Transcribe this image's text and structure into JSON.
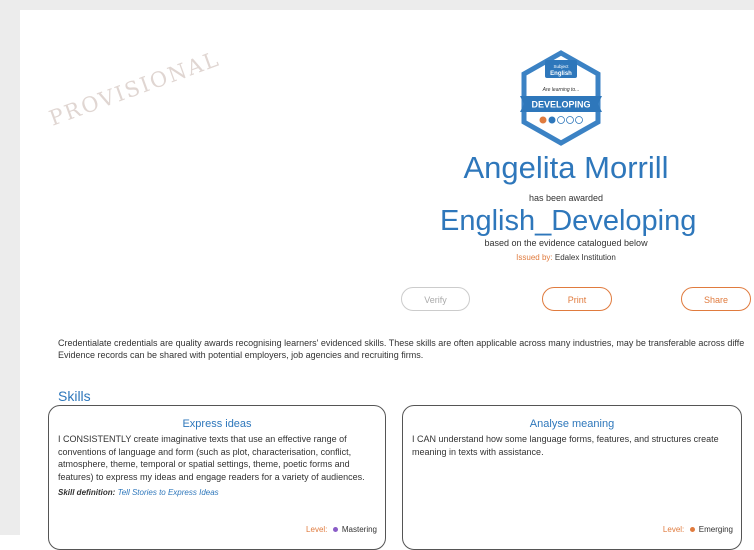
{
  "watermark": "PROVISIONAL",
  "badge": {
    "top_label": "Subject",
    "subject": "English",
    "tagline": "Are learning to...",
    "level": "DEVELOPING",
    "colors": {
      "hex": "#3b82c4",
      "ribbon": "#2e77bb",
      "dot_active": "#e07b3e",
      "dot_second": "#2e77bb"
    }
  },
  "recipient": {
    "name": "Angelita Morrill"
  },
  "awarded_text": "has been awarded",
  "credential": {
    "name": "English_Developing"
  },
  "basis_text": "based on the evidence catalogued below",
  "issuer": {
    "label": "Issued by:",
    "name": "Edalex Institution"
  },
  "actions": {
    "verify": "Verify",
    "print": "Print",
    "share": "Share"
  },
  "description": {
    "line1": "Credentialate credentials are quality awards recognising learners' evidenced skills. These skills are often applicable across many industries, may be transferable across diffe",
    "line2": "Evidence records can be shared with potential employers, job agencies and recruiting firms."
  },
  "skills_heading": "Skills",
  "skills": [
    {
      "title": "Express ideas",
      "text": "I CONSISTENTLY create imaginative texts that use an effective range of conventions of language and form (such as plot, characterisation, conflict, atmosphere, theme, temporal or spatial settings, theme, poetic forms and features) to express my ideas and engage readers for a variety of audiences.",
      "definition_label": "Skill definition:",
      "definition_link": "Tell Stories to Express Ideas",
      "level_label": "Level:",
      "level": "Mastering",
      "level_color": "#8a5cc7"
    },
    {
      "title": "Analyse meaning",
      "text": "I CAN understand how some language forms, features, and structures create meaning in texts with assistance.",
      "level_label": "Level:",
      "level": "Emerging",
      "level_color": "#e07b3e"
    }
  ],
  "colors": {
    "accent": "#2e77bb",
    "highlight": "#e07b3e"
  }
}
